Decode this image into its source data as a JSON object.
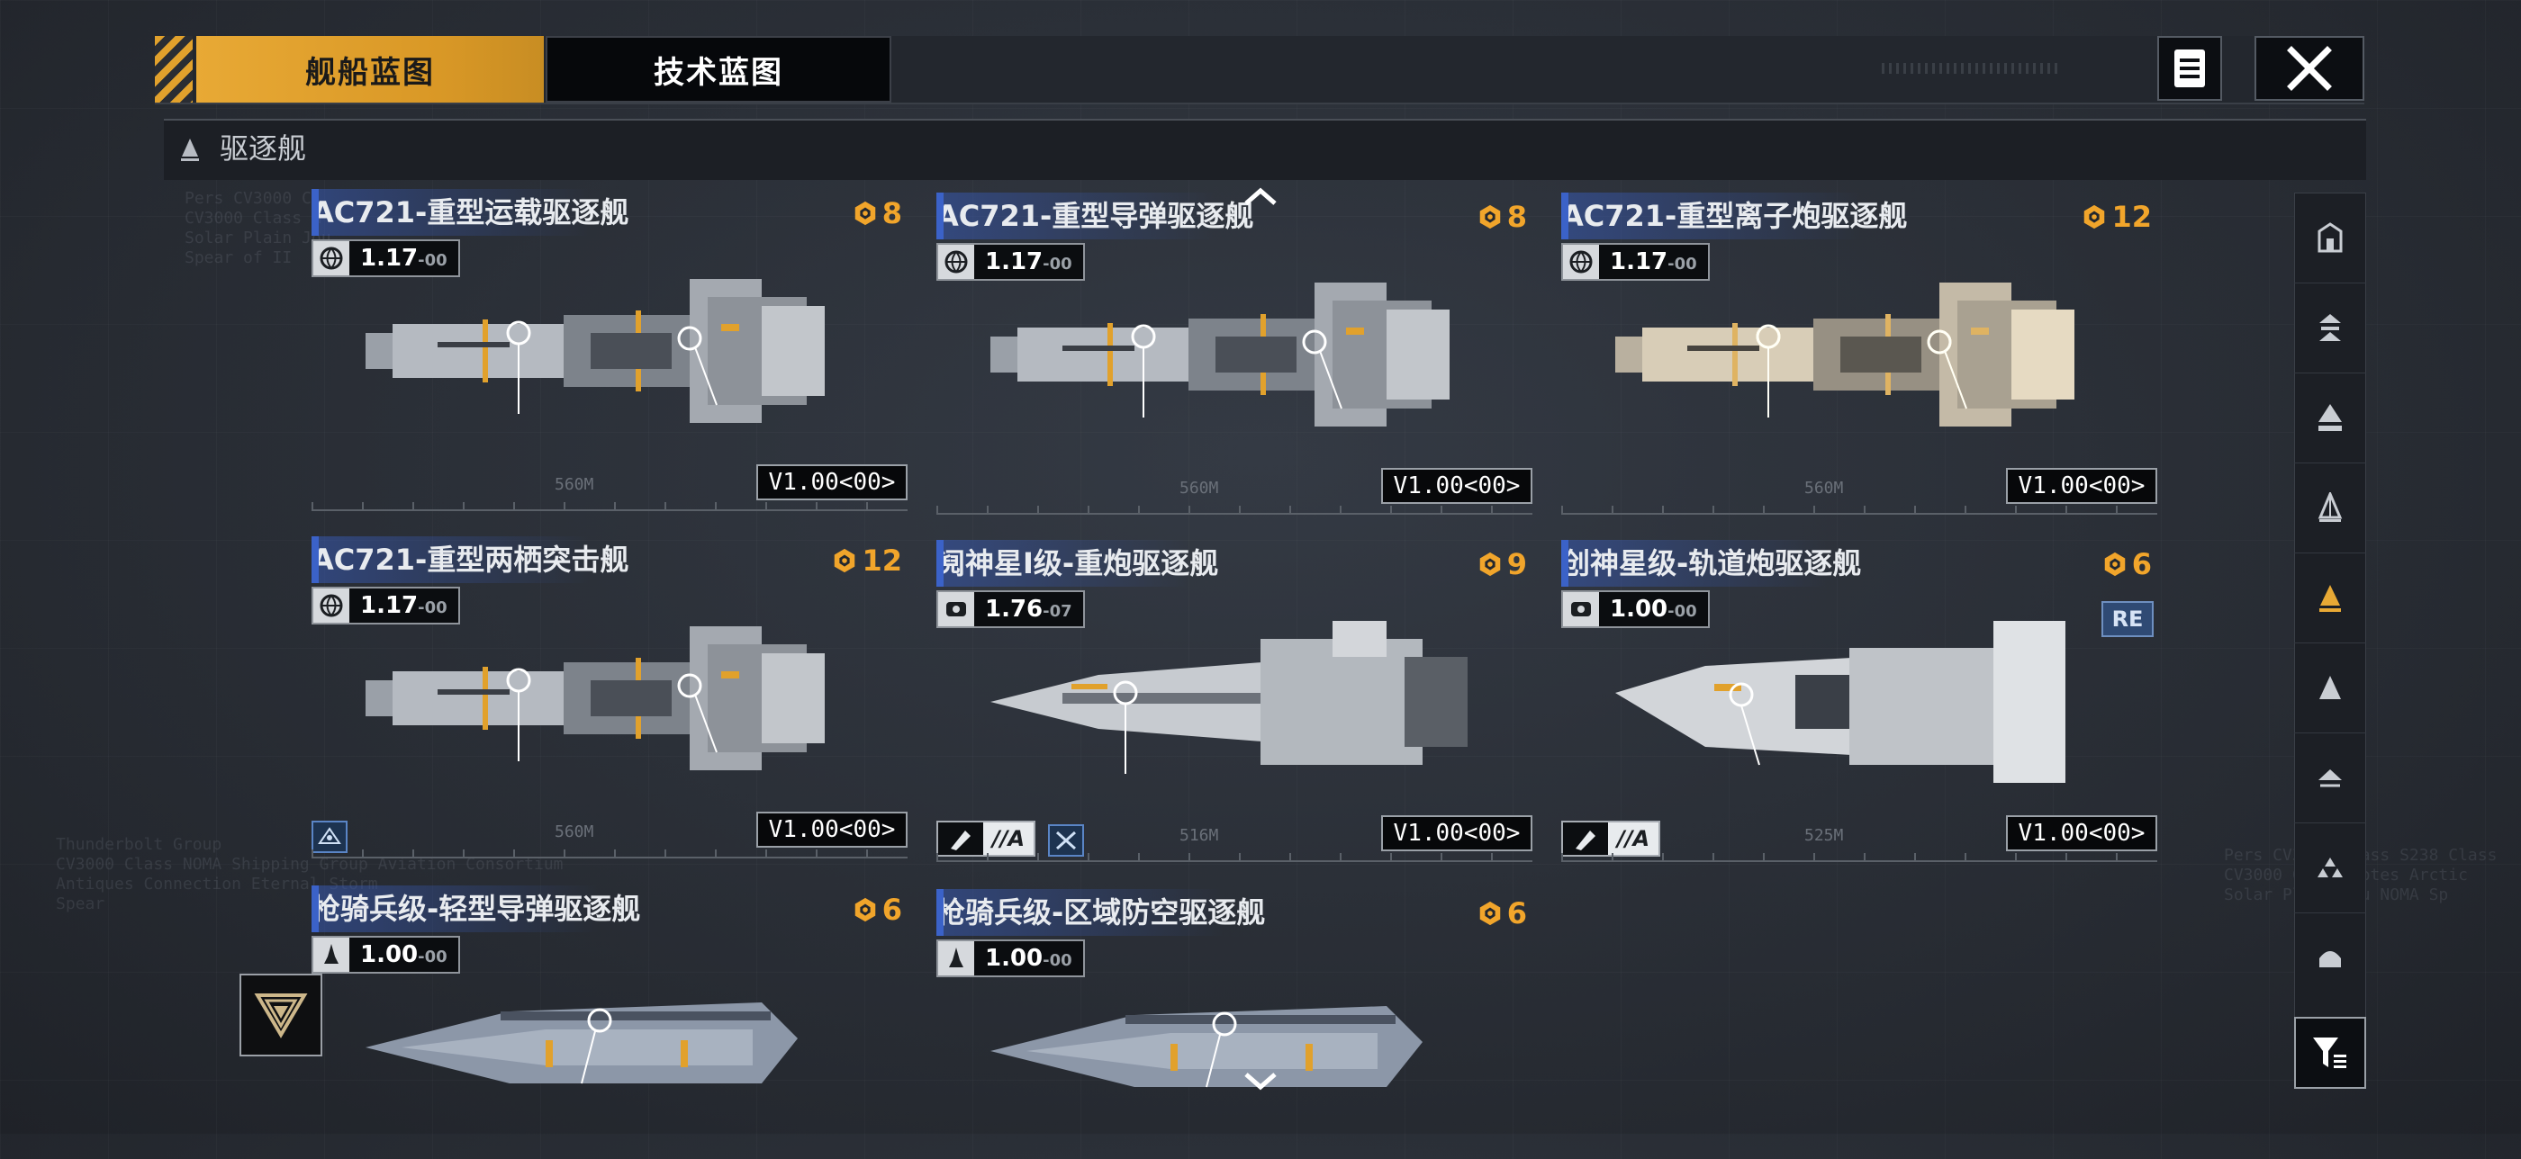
{
  "tabs": [
    {
      "label": "舰船蓝图",
      "active": true
    },
    {
      "label": "技术蓝图",
      "active": false
    }
  ],
  "category": {
    "label": "驱逐舰",
    "icon": "destroyer-class-icon"
  },
  "colors": {
    "accent": "#E8A935",
    "cost": "#F1A52B",
    "title_bar": "#3B62C8",
    "background": "#2B3039"
  },
  "cards": [
    {
      "name": "AC721-重型运载驱逐舰",
      "cost": "8",
      "version": "1.17",
      "version_suffix": "-00",
      "version_icon": "globe-icon",
      "length": "560M",
      "blueprint_version": "V1.00<00>"
    },
    {
      "name": "AC721-重型导弹驱逐舰",
      "cost": "8",
      "version": "1.17",
      "version_suffix": "-00",
      "version_icon": "globe-icon",
      "length": "560M",
      "blueprint_version": "V1.00<00>"
    },
    {
      "name": "AC721-重型离子炮驱逐舰",
      "cost": "12",
      "version": "1.17",
      "version_suffix": "-00",
      "version_icon": "globe-icon",
      "length": "560M",
      "blueprint_version": "V1.00<00>"
    },
    {
      "name": "AC721-重型两栖突击舰",
      "cost": "12",
      "version": "1.17",
      "version_suffix": "-00",
      "version_icon": "globe-icon",
      "length": "560M",
      "blueprint_version": "V1.00<00>"
    },
    {
      "name": "阋神星I级-重炮驱逐舰",
      "cost": "9",
      "version": "1.76",
      "version_suffix": "-07",
      "version_icon": "faction-emblem-icon",
      "length": "516M",
      "blueprint_version": "V1.00<00>",
      "tag": "//A"
    },
    {
      "name": "创神星级-轨道炮驱逐舰",
      "cost": "6",
      "version": "1.00",
      "version_suffix": "-00",
      "version_icon": "faction-emblem-icon",
      "length": "525M",
      "blueprint_version": "V1.00<00>",
      "badge": "RE",
      "tag": "//A"
    },
    {
      "name": "枪骑兵级-轻型导弹驱逐舰",
      "cost": "6",
      "version": "1.00",
      "version_suffix": "-00",
      "version_icon": "rocket-icon"
    },
    {
      "name": "枪骑兵级-区域防空驱逐舰",
      "cost": "6",
      "version": "1.00",
      "version_suffix": "-00",
      "version_icon": "rocket-icon"
    }
  ],
  "sidebar_icons": [
    "carrier-icon",
    "cruiser-icon",
    "battlecruiser-icon",
    "frigate-icon",
    "destroyer-icon",
    "corvette-icon",
    "aircraft-icon",
    "fleet-icon",
    "dome-icon"
  ]
}
